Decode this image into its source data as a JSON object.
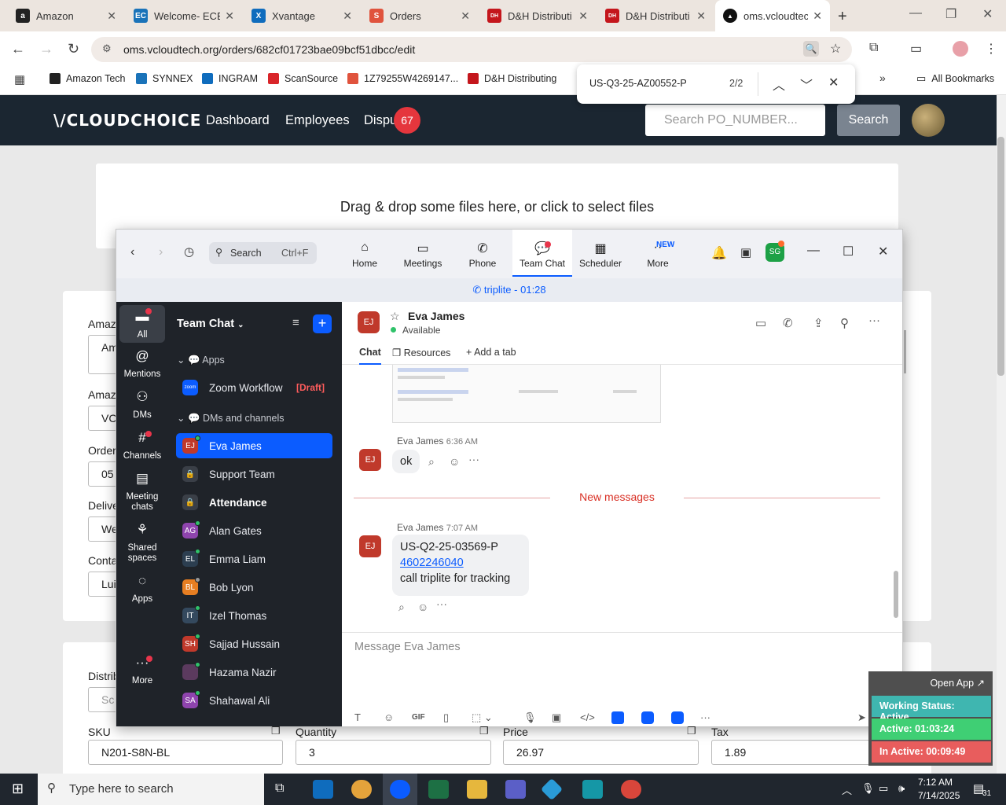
{
  "browser": {
    "tabs": [
      {
        "label": "Amazon",
        "icon": "amazon-icon",
        "color": "#222222",
        "glyph": "a"
      },
      {
        "label": "Welcome- ECE",
        "icon": "ec-icon",
        "color": "#1a73b9",
        "glyph": "EC"
      },
      {
        "label": "Xvantage",
        "icon": "xvantage-icon",
        "color": "#0f6cbd",
        "glyph": "X"
      },
      {
        "label": "Orders",
        "icon": "orders-icon",
        "color": "#e0533d",
        "glyph": "S"
      },
      {
        "label": "D&H Distributi",
        "icon": "dh-icon",
        "color": "#c4161c",
        "glyph": "DH"
      },
      {
        "label": "D&H Distributi",
        "icon": "dh-icon",
        "color": "#c4161c",
        "glyph": "DH"
      },
      {
        "label": "oms.vcloudtec",
        "icon": "vcloud-icon",
        "color": "#111111",
        "glyph": "▲"
      }
    ],
    "url": "oms.vcloudtech.org/orders/682cf01723bae09bcf51dbcc/edit",
    "bookmarks": [
      {
        "label": "Amazon Tech",
        "color": "#222222"
      },
      {
        "label": "SYNNEX",
        "color": "#1a73b9"
      },
      {
        "label": "INGRAM",
        "color": "#0f6cbd"
      },
      {
        "label": "ScanSource",
        "color": "#d9252a"
      },
      {
        "label": "1Z79255W4269147...",
        "color": "#e0533d"
      },
      {
        "label": "D&H Distributing",
        "color": "#c4161c"
      }
    ],
    "all_bookmarks": "All Bookmarks",
    "find": {
      "query": "US-Q3-25-AZ00552-P",
      "count": "2/2"
    }
  },
  "app": {
    "logo": "\\/CLOUDCHOICE",
    "nav": [
      "Dashboard",
      "Employees",
      "Dispu"
    ],
    "disputes_badge": "67",
    "search_placeholder": "Search PO_NUMBER...",
    "search_button": "Search",
    "dropzone_text": "Drag & drop some files here, or click to select files",
    "left_labels": [
      "Amaz",
      "Amaz",
      "Order",
      "Delive",
      "Conta"
    ],
    "left_values": [
      "Am",
      "VC",
      "05",
      "We",
      "Lui"
    ],
    "distrib_label": "Distrib",
    "distrib_value": "Sc",
    "line_item": {
      "sku_label": "SKU",
      "sku": "N201-S8N-BL",
      "qty_label": "Quantity",
      "qty": "3",
      "price_label": "Price",
      "price": "26.97",
      "tax_label": "Tax",
      "tax": "1.89"
    }
  },
  "zoom": {
    "search_label": "Search",
    "search_shortcut": "Ctrl+F",
    "tabs": [
      "Home",
      "Meetings",
      "Phone",
      "Team Chat",
      "Scheduler",
      "More"
    ],
    "new_badge": "NEW",
    "user_initials": "SG",
    "call_bar": "triplite",
    "call_time": "- 01:28",
    "rail": [
      "All",
      "Mentions",
      "DMs",
      "Channels",
      "Meeting chats",
      "Shared spaces",
      "Apps",
      "More"
    ],
    "sidebar": {
      "title": "Team Chat",
      "section_apps": "Apps",
      "zoom_workflow": "Zoom Workflow",
      "draft": "[Draft]",
      "section_dms": "DMs and channels",
      "items": [
        {
          "name": "Eva James",
          "initials": "EJ",
          "color": "#c0392b"
        },
        {
          "name": "Support Team",
          "initials": "",
          "color": "#3a3f47"
        },
        {
          "name": "Attendance",
          "initials": "",
          "color": "#3a3f47"
        },
        {
          "name": "Alan Gates",
          "initials": "AG",
          "color": "#8e44ad"
        },
        {
          "name": "Emma Liam",
          "initials": "EL",
          "color": "#2c3e50"
        },
        {
          "name": "Bob Lyon",
          "initials": "BL",
          "color": "#e67e22"
        },
        {
          "name": "Izel Thomas",
          "initials": "IT",
          "color": "#34495e"
        },
        {
          "name": "Sajjad Hussain",
          "initials": "SH",
          "color": "#c0392b"
        },
        {
          "name": "Hazama Nazir",
          "initials": "",
          "color": "#5b3a5e"
        },
        {
          "name": "Shahawal Ali",
          "initials": "SA",
          "color": "#8e44ad"
        }
      ]
    },
    "chat": {
      "contact": "Eva James",
      "contact_initials": "EJ",
      "status": "Available",
      "tab_chat": "Chat",
      "tab_resources": "Resources",
      "tab_add": "Add a tab",
      "msg1_sender": "Eva James",
      "msg1_time": "6:36 AM",
      "msg1_text": "ok",
      "new_messages": "New messages",
      "msg2_sender": "Eva James",
      "msg2_time": "7:07 AM",
      "msg2_line1": "US-Q2-25-03569-P",
      "msg2_link": "4602246040",
      "msg2_line3": "call triplite for tracking",
      "compose_placeholder": "Message Eva James"
    }
  },
  "work_status": {
    "open_app": "Open App",
    "status": "Working Status: Active",
    "active": "Active: 01:03:24",
    "inactive": "In Active: 00:09:49"
  },
  "taskbar": {
    "search": "Type here to search",
    "time": "7:12 AM",
    "date": "7/14/2025",
    "notif": "31"
  }
}
